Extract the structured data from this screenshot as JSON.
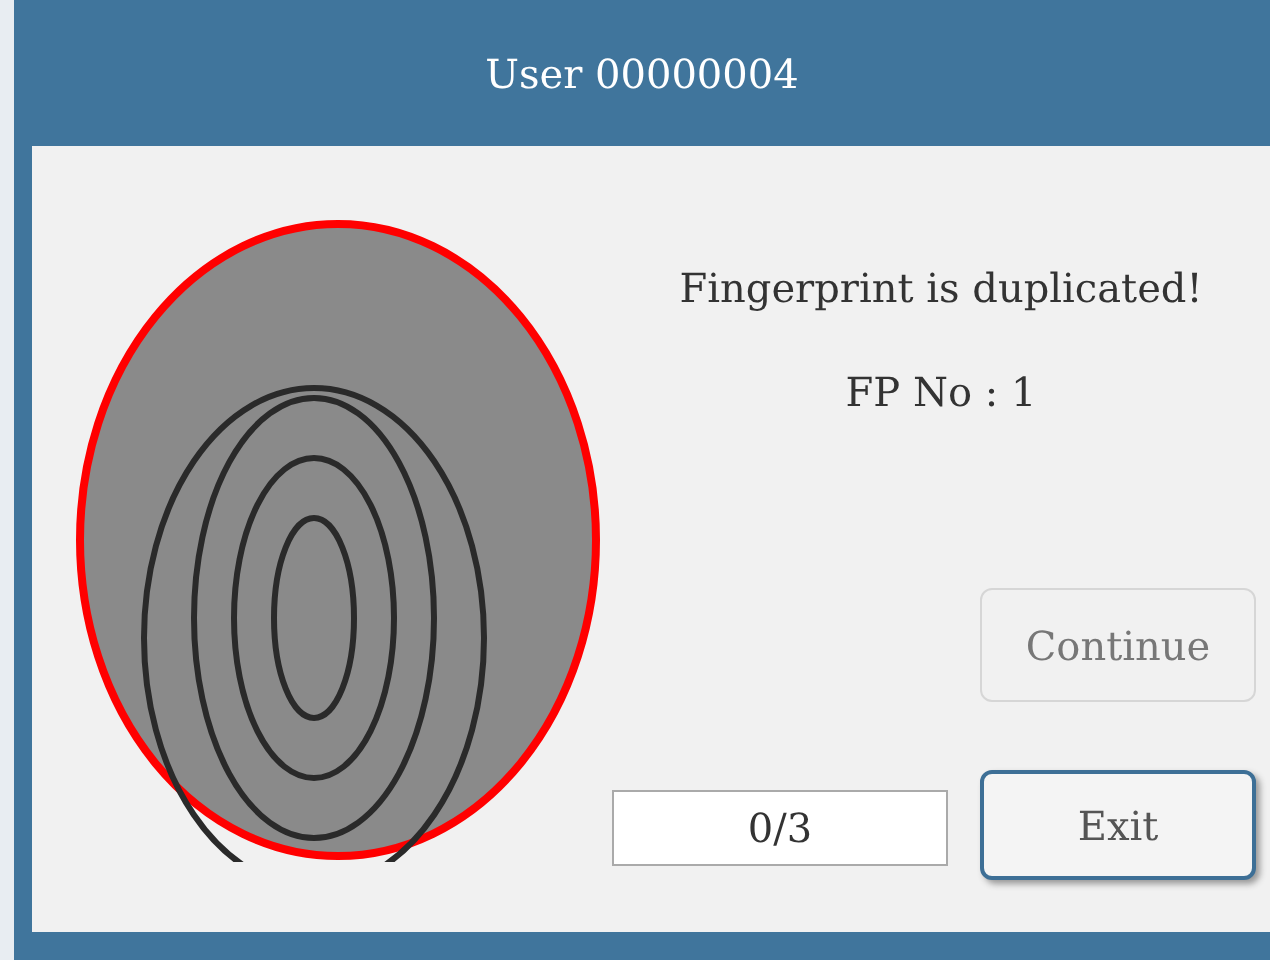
{
  "window": {
    "title": "User 00000004"
  },
  "message": "Fingerprint is duplicated!",
  "fp_number": "FP No : 1",
  "progress": "0/3",
  "buttons": [
    {
      "label": "Continue",
      "disabled": true
    },
    {
      "label": "Exit",
      "disabled": false
    }
  ]
}
